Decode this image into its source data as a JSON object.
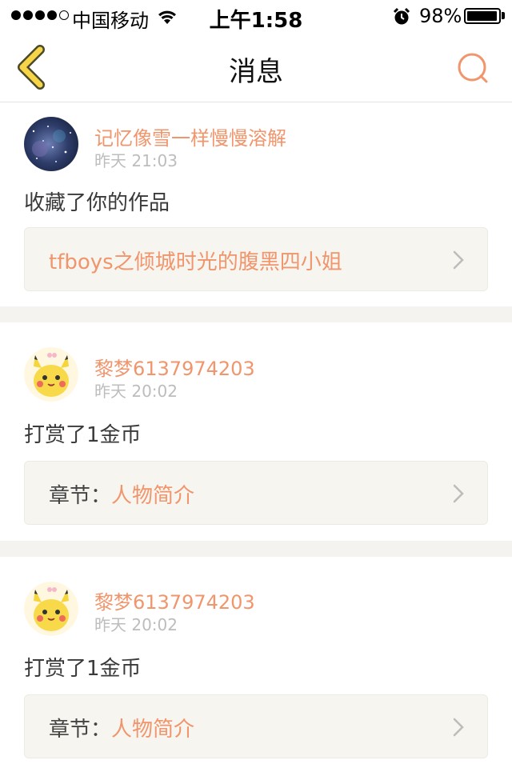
{
  "status_bar": {
    "carrier": "中国移动",
    "time": "上午1:58",
    "battery": "98%",
    "battery_level": 0.98
  },
  "nav": {
    "title": "消息",
    "back_icon": "chevron-left-icon",
    "search_icon": "search-icon"
  },
  "colors": {
    "accent": "#f0956c",
    "back_icon_fill": "#f7d548",
    "ref_bg": "#f6f5ef",
    "divider": "#f4f3ef"
  },
  "messages": [
    {
      "user": "记忆像雪一样慢慢溶解",
      "time": "昨天 21:03",
      "action": "收藏了你的作品",
      "ref_prefix": "",
      "ref_text": "tfboys之倾城时光的腹黑四小姐",
      "avatar": "galaxy-avatar"
    },
    {
      "user": "黎梦6137974203",
      "time": "昨天 20:02",
      "action": "打赏了1金币",
      "ref_prefix": "章节：",
      "ref_text": "人物简介",
      "avatar": "pikachu-avatar"
    },
    {
      "user": "黎梦6137974203",
      "time": "昨天 20:02",
      "action": "打赏了1金币",
      "ref_prefix": "章节：",
      "ref_text": "人物简介",
      "avatar": "pikachu-avatar"
    }
  ]
}
